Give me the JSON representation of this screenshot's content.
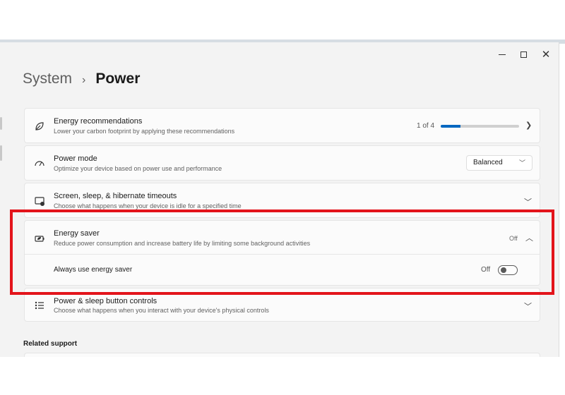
{
  "window": {
    "breadcrumb_parent": "System",
    "breadcrumb_separator": "›",
    "breadcrumb_current": "Power"
  },
  "settings": [
    {
      "id": "energy-recommendations",
      "icon": "leaf-icon",
      "title": "Energy recommendations",
      "subtitle": "Lower your carbon footprint by applying these recommendations",
      "progress_text": "1 of 4",
      "progress_fraction": 0.25
    },
    {
      "id": "power-mode",
      "icon": "gauge-icon",
      "title": "Power mode",
      "subtitle": "Optimize your device based on power use and performance",
      "dropdown_value": "Balanced"
    },
    {
      "id": "screen-sleep",
      "icon": "screen-sleep-icon",
      "title": "Screen, sleep, & hibernate timeouts",
      "subtitle": "Choose what happens when your device is idle for a specified time"
    },
    {
      "id": "energy-saver",
      "icon": "battery-leaf-icon",
      "title": "Energy saver",
      "subtitle": "Reduce power consumption and increase battery life by limiting some background activities",
      "status": "Off",
      "sub_setting_label": "Always use energy saver",
      "sub_setting_state": "Off",
      "sub_setting_on": false
    },
    {
      "id": "power-buttons",
      "icon": "list-icon",
      "title": "Power & sleep button controls",
      "subtitle": "Choose what happens when you interact with your device's physical controls"
    }
  ],
  "related": {
    "heading": "Related support"
  },
  "colors": {
    "accent": "#0067c0",
    "highlight": "#e3141b"
  }
}
